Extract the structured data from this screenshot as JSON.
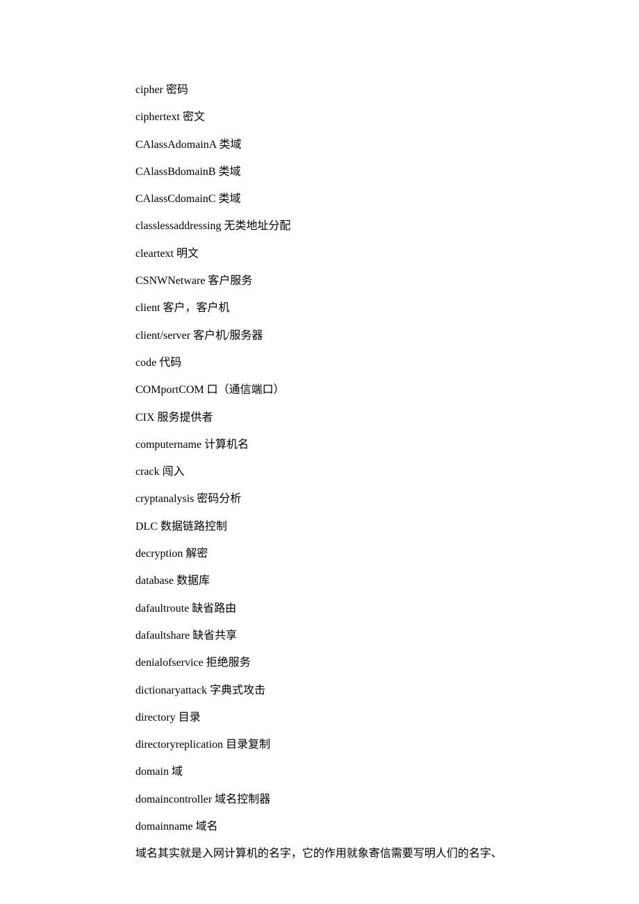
{
  "entries": [
    "cipher 密码",
    "ciphertext 密文",
    "CAlassAdomainA 类域",
    "CAlassBdomainB 类域",
    "CAlassCdomainC 类域",
    "classlessaddressing 无类地址分配",
    "cleartext 明文",
    "CSNWNetware 客户服务",
    "client 客户，客户机",
    "client/server 客户机/服务器",
    "code 代码",
    "COMportCOM 口（通信端口）",
    "CIX 服务提供者",
    "computername 计算机名",
    "crack 闯入",
    "cryptanalysis 密码分析",
    "DLC 数据链路控制",
    "decryption 解密",
    "database 数据库",
    "dafaultroute 缺省路由",
    "dafaultshare 缺省共享",
    "denialofservice 拒绝服务",
    "dictionaryattack 字典式攻击",
    "directory 目录",
    "directoryreplication 目录复制",
    "domain 域",
    "domaincontroller 域名控制器",
    "domainname 域名",
    "域名其实就是入网计算机的名字，它的作用就象寄信需要写明人们的名字、"
  ]
}
